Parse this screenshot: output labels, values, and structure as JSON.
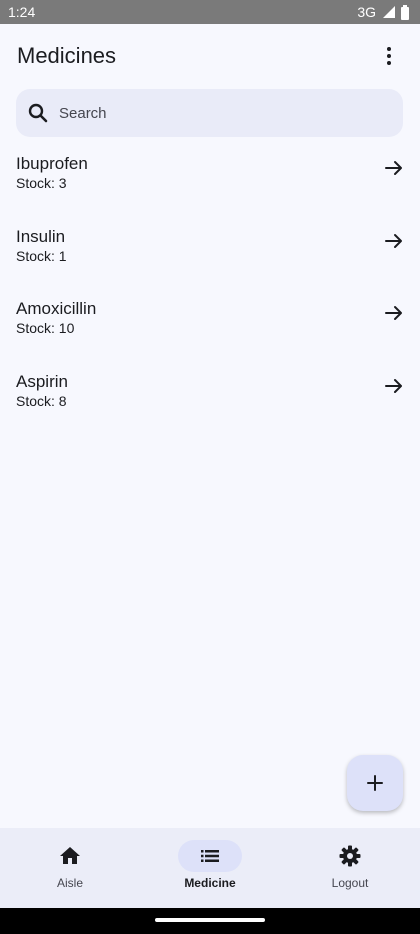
{
  "status_bar": {
    "time": "1:24",
    "network": "3G",
    "icons": [
      "signal-icon",
      "battery-icon"
    ]
  },
  "app_bar": {
    "title": "Medicines",
    "menu_icon": "more-vert-icon"
  },
  "search": {
    "placeholder": "Search",
    "value": "",
    "icon": "search-icon"
  },
  "medicines": [
    {
      "name": "Ibuprofen",
      "stock": "Stock: 3"
    },
    {
      "name": "Insulin",
      "stock": "Stock: 1"
    },
    {
      "name": "Amoxicillin",
      "stock": "Stock: 10"
    },
    {
      "name": "Aspirin",
      "stock": "Stock: 8"
    }
  ],
  "fab": {
    "icon": "add-icon"
  },
  "bottom_nav": {
    "items": [
      {
        "label": "Aisle",
        "icon": "home-icon",
        "active": false
      },
      {
        "label": "Medicine",
        "icon": "list-icon",
        "active": true
      },
      {
        "label": "Logout",
        "icon": "gear-icon",
        "active": false
      }
    ]
  },
  "colors": {
    "background": "#f7f8fe",
    "search_bg": "#e9ebf8",
    "nav_bg": "#ebedf8",
    "active_indicator": "#dde1f9",
    "status_bar": "#7a7a7a"
  }
}
